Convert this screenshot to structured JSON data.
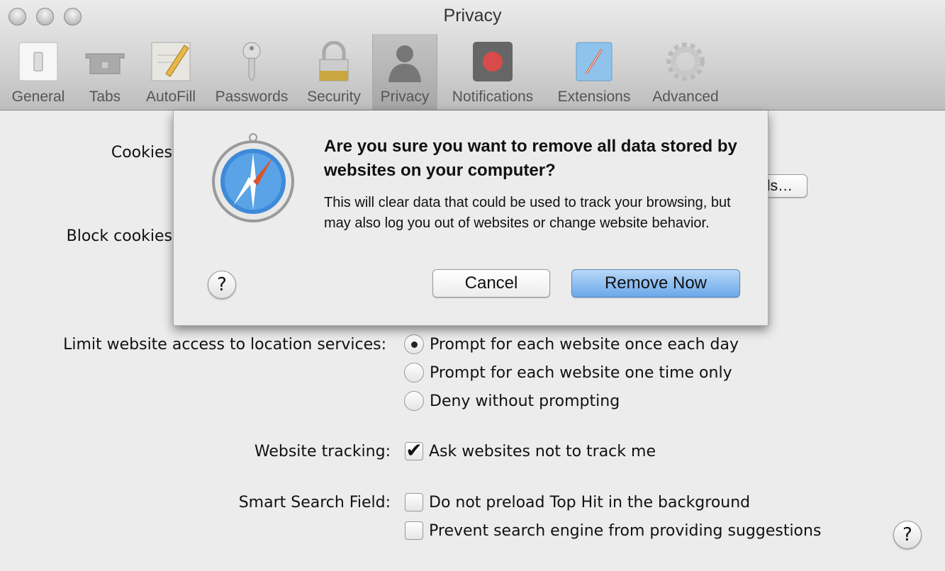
{
  "window": {
    "title": "Privacy"
  },
  "toolbar": {
    "items": [
      {
        "label": "General",
        "icon": "light-switch-icon"
      },
      {
        "label": "Tabs",
        "icon": "tabs-icon"
      },
      {
        "label": "AutoFill",
        "icon": "autofill-pencil-icon"
      },
      {
        "label": "Passwords",
        "icon": "key-icon"
      },
      {
        "label": "Security",
        "icon": "padlock-icon"
      },
      {
        "label": "Privacy",
        "icon": "person-silhouette-icon",
        "selected": true
      },
      {
        "label": "Notifications",
        "icon": "notification-record-icon"
      },
      {
        "label": "Extensions",
        "icon": "extension-puzzle-icon"
      },
      {
        "label": "Advanced",
        "icon": "gear-icon"
      }
    ]
  },
  "settings": {
    "cookies_label": "Cookies",
    "details_button": "Details…",
    "block_cookies_label": "Block cookies",
    "location_label": "Limit website access to location services:",
    "location_options": [
      {
        "label": "Prompt for each website once each day",
        "selected": true
      },
      {
        "label": "Prompt for each website one time only",
        "selected": false
      },
      {
        "label": "Deny without prompting",
        "selected": false
      }
    ],
    "tracking_label": "Website tracking:",
    "tracking_option": {
      "label": "Ask websites not to track me",
      "checked": true
    },
    "smart_search_label": "Smart Search Field:",
    "smart_search_options": [
      {
        "label": "Do not preload Top Hit in the background",
        "checked": false
      },
      {
        "label": "Prevent search engine from providing suggestions",
        "checked": false
      }
    ],
    "help": "?"
  },
  "dialog": {
    "icon": "safari-compass-icon",
    "title": "Are you sure you want to remove all data stored by websites on your computer?",
    "message": "This will clear data that could be used to track your browsing, but may also log you out of websites or change website behavior.",
    "help": "?",
    "cancel": "Cancel",
    "confirm": "Remove Now",
    "accent": "#7fb6f0"
  }
}
